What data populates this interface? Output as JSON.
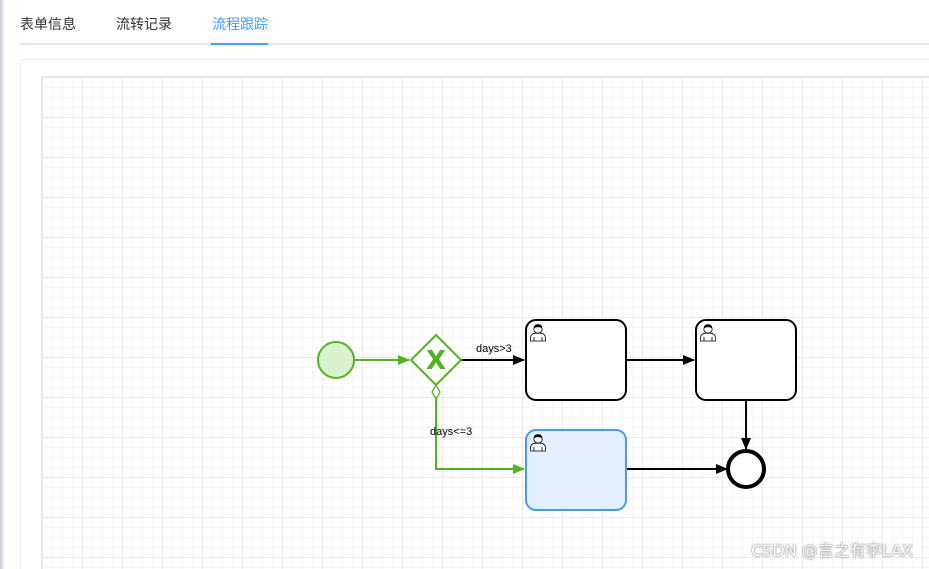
{
  "tabs": {
    "items": [
      {
        "label": "表单信息",
        "active": false
      },
      {
        "label": "流转记录",
        "active": false
      },
      {
        "label": "流程跟踪",
        "active": true
      }
    ]
  },
  "diagram": {
    "gateway_symbol": "X",
    "flows": {
      "gateway_to_task1": "days>3",
      "gateway_to_task3": "days<=3"
    },
    "colors": {
      "completed": "#52b320",
      "completed_fill": "#daf1cf",
      "active_stroke": "#4a9be3",
      "active_fill": "#e3effc",
      "pending": "#000000"
    },
    "icons": {
      "start_event": "circle",
      "gateway": "exclusive-gateway-diamond",
      "user_task": "user-icon",
      "end_event": "bold-circle"
    }
  },
  "watermark": "CSDN @言之有李LAX"
}
